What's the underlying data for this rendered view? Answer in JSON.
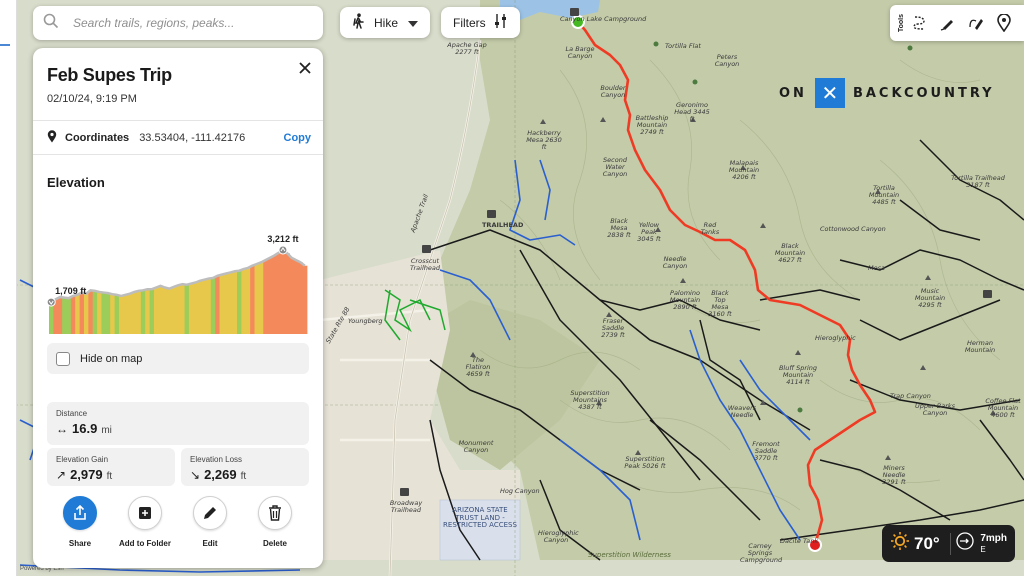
{
  "search": {
    "placeholder": "Search trails, regions, peaks..."
  },
  "toolbar": {
    "activity_label": "Hike",
    "filters_label": "Filters",
    "tools_label": "Tools"
  },
  "brand": {
    "left": "ON",
    "right": "BACKCOUNTRY"
  },
  "panel": {
    "title": "Feb Supes Trip",
    "date": "02/10/24, 9:19 PM",
    "coordinates_label": "Coordinates",
    "coordinates_value": "33.53404, -111.42176",
    "copy_label": "Copy",
    "elevation_title": "Elevation",
    "elevation_min": "1,709 ft",
    "elevation_max": "3,212 ft",
    "elevation_profile": [
      0.07,
      0.12,
      0.16,
      0.15,
      0.14,
      0.18,
      0.2,
      0.24,
      0.22,
      0.28,
      0.27,
      0.25,
      0.24,
      0.23,
      0.21,
      0.2,
      0.18,
      0.2,
      0.22,
      0.25,
      0.27,
      0.28,
      0.3,
      0.3,
      0.33,
      0.36,
      0.33,
      0.31,
      0.34,
      0.37,
      0.39,
      0.38,
      0.4,
      0.42,
      0.45,
      0.47,
      0.49,
      0.5,
      0.54,
      0.56,
      0.58,
      0.6,
      0.62,
      0.63,
      0.66,
      0.68,
      0.72,
      0.75,
      0.78,
      0.82,
      0.86,
      0.9,
      0.95,
      1.0,
      0.94,
      0.86,
      0.82,
      0.78,
      0.72
    ],
    "hide_on_map_label": "Hide on map",
    "distance_label": "Distance",
    "distance_value": "16.9",
    "distance_unit": "mi",
    "gain_label": "Elevation Gain",
    "gain_value": "2,979",
    "gain_unit": "ft",
    "loss_label": "Elevation Loss",
    "loss_value": "2,269",
    "loss_unit": "ft",
    "actions": [
      {
        "label": "Share",
        "icon": "share-icon"
      },
      {
        "label": "Add to Folder",
        "icon": "folder-add-icon"
      },
      {
        "label": "Edit",
        "icon": "pencil-icon"
      },
      {
        "label": "Delete",
        "icon": "trash-icon"
      }
    ]
  },
  "weather": {
    "temperature": "70°",
    "wind_speed": "7mph",
    "wind_direction": "E"
  },
  "map": {
    "credit": "Powered by Esri",
    "labels": [
      "Canyon Lake Campground",
      "Apache Gap 2277 ft",
      "La Barge Canyon",
      "Tortilla Flat",
      "Peters Canyon",
      "Boulder Canyon",
      "Battleship Mountain 2749 ft",
      "Geronimo Head 3445 ft",
      "Hackberry Mesa 2630 ft",
      "Second Water Canyon",
      "Malapais Mountain 4206 ft",
      "Tortilla Mountain 4485 ft",
      "Tortilla Trailhead 3187 ft",
      "Black Mesa 2838 ft",
      "Yellow Peak 3045 ft",
      "Red Tanks",
      "Cottonwood Canyon",
      "Black Mountain 4627 ft",
      "Crosscut Trailhead",
      "Needle Canyon",
      "Mesa",
      "Palomino Mountain 2890 ft",
      "Black Top Mesa 3160 ft",
      "Music Mountain 4295 ft",
      "Youngberg",
      "Hieroglyphic",
      "Fraser Saddle 2739 ft",
      "Bluff Spring Mountain 4114 ft",
      "Herman Mountain",
      "The Flatiron 4659 ft",
      "Superstition Mountains 4387 ft",
      "Weavers Needle",
      "Trap Canyon",
      "Upper Barks Canyon",
      "Coffee Flat Mountain 4600 ft",
      "Monument Canyon",
      "Fremont Saddle 3770 ft",
      "Superstition Peak 5026 ft",
      "Miners Needle 3291 ft",
      "Hog Canyon",
      "Broadway Trailhead",
      "ARIZONA STATE TRUST LAND - RESTRICTED ACCESS",
      "Hieroglyphic Canyon",
      "Superstition Wilderness",
      "Carney Springs Campground",
      "Peralta Trailhead",
      "TRAILHEAD",
      "Apache Trail",
      "State Rte 88",
      "Dacite Tank",
      "Hieroglyphic Canyon"
    ]
  },
  "colors": {
    "accent": "#1f7bd6",
    "route": "#ef3b24",
    "trail_blue": "#2a5fd0",
    "trail_green": "#1faa2e",
    "trail_black": "#1a1a1a",
    "start_marker": "#45b822",
    "end_marker": "#e01e1e",
    "weather_bg": "#1e1e1e"
  }
}
